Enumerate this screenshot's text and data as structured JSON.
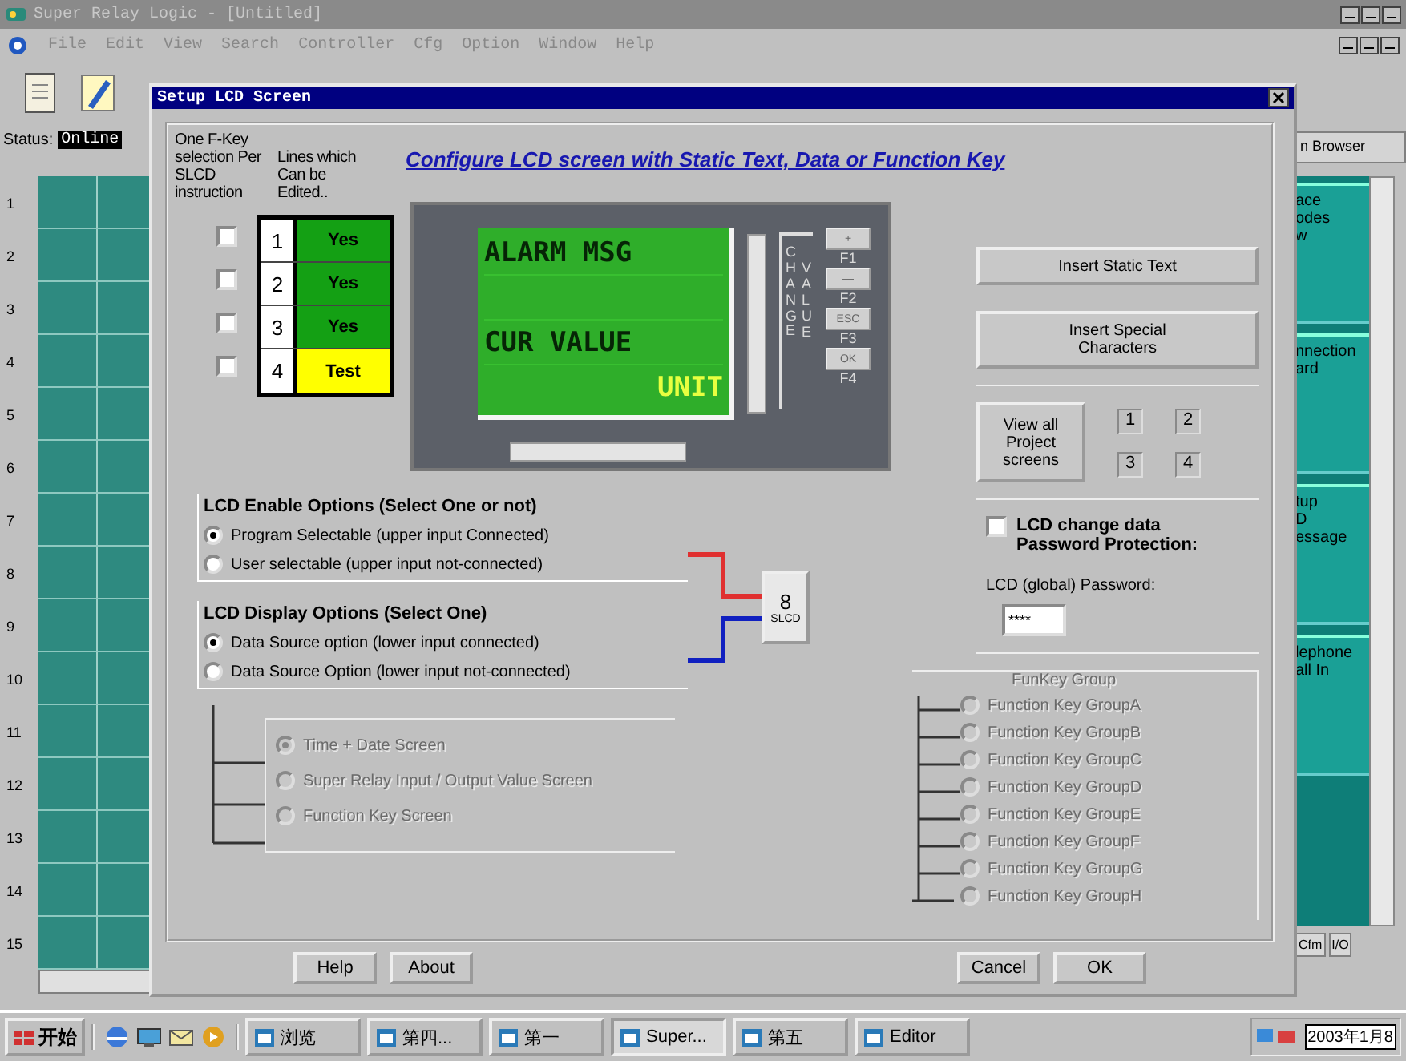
{
  "app": {
    "title": "Super Relay Logic - [Untitled]",
    "menu": [
      "File",
      "Edit",
      "View",
      "Search",
      "Controller",
      "Cfg",
      "Option",
      "Window",
      "Help"
    ],
    "status_label": "Status:",
    "status_value": "Online",
    "browser_label": "n Browser",
    "row_numbers": [
      "1",
      "2",
      "3",
      "4",
      "5",
      "6",
      "7",
      "8",
      "9",
      "10",
      "11",
      "12",
      "13",
      "14",
      "15"
    ],
    "side_cards": [
      {
        "lines": [
          "ace",
          "odes",
          "w"
        ]
      },
      {
        "lines": [
          "nnection",
          "ard"
        ]
      },
      {
        "lines": [
          "tup",
          "D",
          "essage"
        ]
      },
      {
        "lines": [
          "lephone",
          "all In"
        ]
      }
    ],
    "side_tools": [
      "Cfm",
      "I/O"
    ]
  },
  "dialog": {
    "title": "Setup LCD Screen",
    "fkey_note": "One F-Key selection Per SLCD instruction",
    "lines_note": "Lines which Can be Edited..",
    "heading": "Configure LCD screen with Static Text, Data or Function Key",
    "lines": [
      {
        "number": "1",
        "editable": "Yes",
        "kind": "yes",
        "checked": false
      },
      {
        "number": "2",
        "editable": "Yes",
        "kind": "yes",
        "checked": false
      },
      {
        "number": "3",
        "editable": "Yes",
        "kind": "yes",
        "checked": false
      },
      {
        "number": "4",
        "editable": "Test",
        "kind": "test",
        "checked": false
      }
    ],
    "lcd": {
      "rows": [
        {
          "kind": "text",
          "text": "ALARM MSG"
        },
        {
          "kind": "blank"
        },
        {
          "kind": "text",
          "text": "CUR VALUE"
        },
        {
          "kind": "unit",
          "text": "UNIT"
        }
      ],
      "side_label_1": "CHANGE",
      "side_label_2": "VALUE",
      "keys": [
        {
          "symbol": "+",
          "label": "F1"
        },
        {
          "symbol": "—",
          "label": "F2"
        },
        {
          "symbol": "ESC",
          "label": "F3"
        },
        {
          "symbol": "OK",
          "label": "F4"
        }
      ]
    },
    "enable_options": {
      "title": "LCD Enable Options (Select One or not)",
      "options": [
        {
          "label": "Program Selectable (upper input Connected)",
          "selected": true
        },
        {
          "label": "User selectable (upper input not-connected)",
          "selected": false
        }
      ]
    },
    "display_options": {
      "title": "LCD Display Options (Select One)",
      "options": [
        {
          "label": "Data Source option (lower input connected)",
          "selected": true
        },
        {
          "label": "Data Source Option (lower input not-connected)",
          "selected": false
        }
      ]
    },
    "block": {
      "number": "8",
      "label": "SLCD"
    },
    "screen_options": {
      "disabled": true,
      "options": [
        {
          "label": "Time + Date Screen",
          "selected": true
        },
        {
          "label": "Super Relay Input / Output Value Screen",
          "selected": false
        },
        {
          "label": "Function Key Screen",
          "selected": false
        }
      ]
    },
    "insert_static": "Insert Static Text",
    "insert_special": "Insert Special Characters",
    "view_all": "View all Project screens",
    "screens": [
      "1",
      "2",
      "3",
      "4"
    ],
    "password_protection": {
      "label": "LCD change data Password Protection:",
      "checked": false
    },
    "password_label": "LCD (global) Password:",
    "password": "****",
    "funkey": {
      "title": "FunKey Group",
      "disabled": true,
      "options": [
        {
          "label": "Function Key GroupA",
          "selected": false
        },
        {
          "label": "Function Key GroupB",
          "selected": false
        },
        {
          "label": "Function Key GroupC",
          "selected": false
        },
        {
          "label": "Function Key GroupD",
          "selected": false
        },
        {
          "label": "Function Key GroupE",
          "selected": false
        },
        {
          "label": "Function Key GroupF",
          "selected": false
        },
        {
          "label": "Function Key GroupG",
          "selected": false
        },
        {
          "label": "Function Key GroupH",
          "selected": false
        }
      ]
    },
    "buttons": {
      "help": "Help",
      "about": "About",
      "cancel": "Cancel",
      "ok": "OK"
    }
  },
  "taskbar": {
    "start": "开始",
    "tasks": [
      {
        "label": "浏览",
        "selected": false
      },
      {
        "label": "第四...",
        "selected": false
      },
      {
        "label": "第一",
        "selected": false
      },
      {
        "label": "Super...",
        "selected": true
      },
      {
        "label": "第五",
        "selected": false
      },
      {
        "label": "Editor",
        "selected": false
      }
    ],
    "clock": "2003年1月8"
  }
}
